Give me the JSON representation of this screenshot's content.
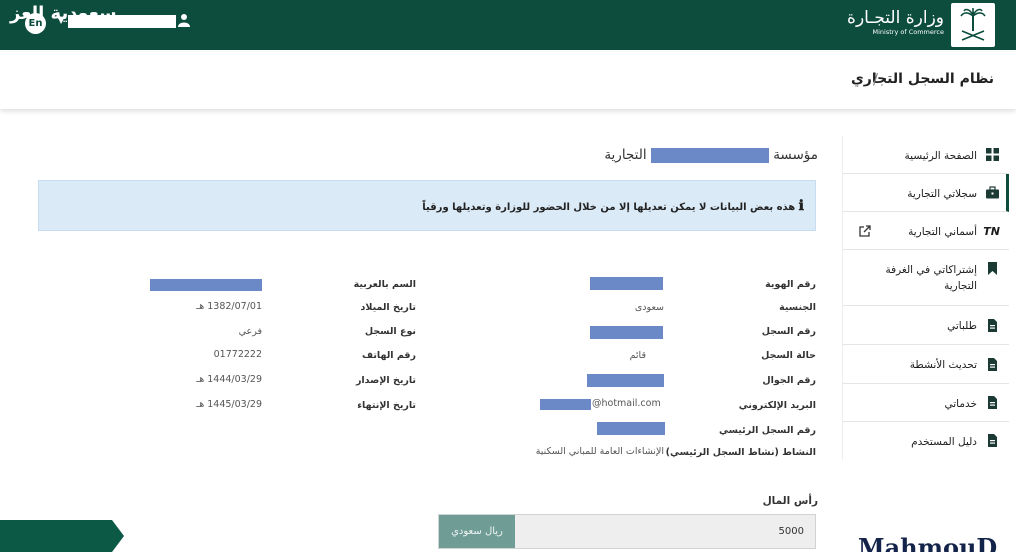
{
  "header": {
    "lang_button": "En",
    "ministry_ar": "وزارة التجـارة",
    "ministry_en": "Ministry of Commerce"
  },
  "page": {
    "title": "نظام السجل التجاري",
    "separator": "/"
  },
  "sidebar": {
    "items": [
      {
        "label": "الصفحة الرئيسية",
        "icon": "grid-icon"
      },
      {
        "label": "سجلاتي التجارية",
        "icon": "briefcase-icon",
        "active": true
      },
      {
        "label": "أسماني التجارية",
        "icon": "tn-icon",
        "prefix": "TN"
      },
      {
        "label": "إشتراكاتي في الغرفة التجارية",
        "icon": "bookmark-icon"
      },
      {
        "label": "طلباتي",
        "icon": "document-icon"
      },
      {
        "label": "تحديث الأنشطة",
        "icon": "document-icon"
      },
      {
        "label": "خدماتي",
        "icon": "document-icon"
      },
      {
        "label": "دليل المستخدم",
        "icon": "document-icon"
      }
    ]
  },
  "establishment": {
    "prefix": "مؤسسة",
    "suffix": "التجارية"
  },
  "notice": {
    "text": "هذه بعض البيانات لا يمكن تعديلها إلا من خلال الحضور للوزارة وتعديلها ورقياً"
  },
  "fields_right": [
    {
      "label": "رقم الهوية",
      "value": ""
    },
    {
      "label": "الجنسية",
      "value": "سعودى"
    },
    {
      "label": "رقم السجل",
      "value": ""
    },
    {
      "label": "حالة السجل",
      "value": "قائم"
    },
    {
      "label": "رقم الجوال",
      "value": ""
    },
    {
      "label": "البريد الإلكتروني",
      "value": "@hotmail.com"
    },
    {
      "label": "رقم السجل الرئيسي",
      "value": ""
    },
    {
      "label": "النشاط (نشاط السجل الرئيسي)",
      "value": "الإنشاءات العامة للمباني السكنية"
    }
  ],
  "fields_left": [
    {
      "label": "السم بالعربية",
      "value": ""
    },
    {
      "label": "تاريخ الميلاد",
      "value": "1382/07/01 هـ"
    },
    {
      "label": "نوع السجل",
      "value": "فرعي"
    },
    {
      "label": "رقم الهاتف",
      "value": "01772222"
    },
    {
      "label": "تاريخ الإصدار",
      "value": "1444/03/29 هـ"
    },
    {
      "label": "تاريخ الإنتهاء",
      "value": "1445/03/29 هـ"
    }
  ],
  "capital": {
    "label": "رأس المال",
    "currency": "ريال سعودي",
    "value": "5000"
  },
  "overlay": {
    "channel_badge": "سعودية العز",
    "watermark": "MahmouD"
  },
  "colors": {
    "header_bg": "#0c4d3e",
    "notice_bg": "#dbeaf7",
    "redaction": "#6b88c7",
    "currency_addon": "#6f9d95"
  }
}
